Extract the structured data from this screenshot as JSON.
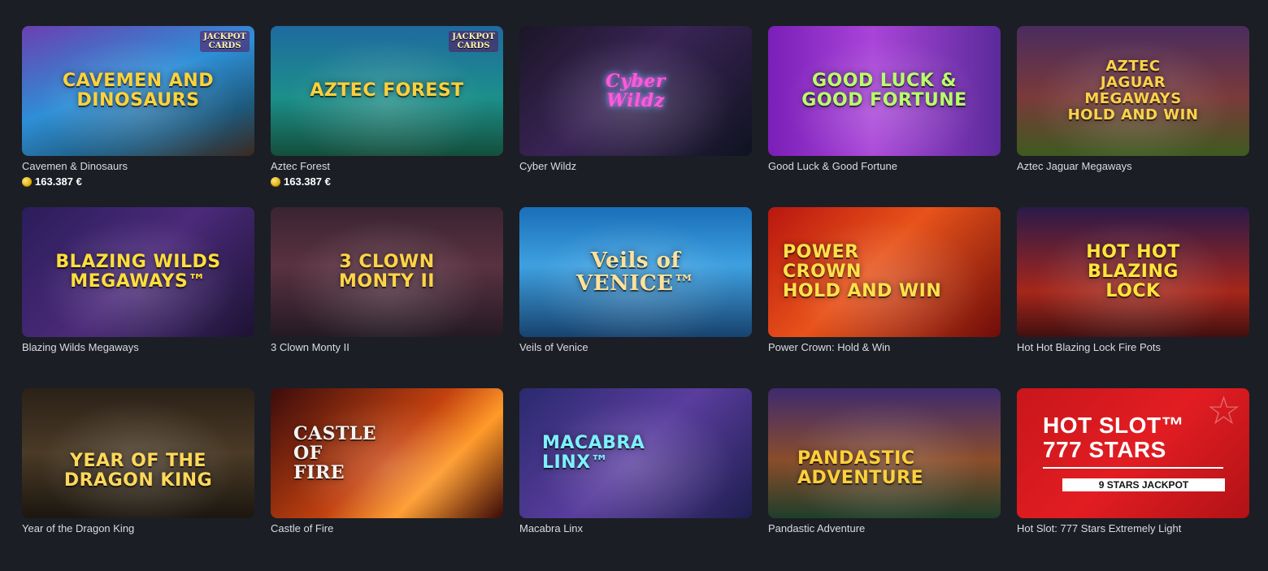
{
  "games": [
    {
      "title": "Cavemen & Dinosaurs",
      "logo": "CAVEMEN AND\nDINOSAURS",
      "badge": "JACKPOT\nCARDS",
      "jackpot": "163.387 €",
      "cls": "bg0",
      "logo_cls": "c-cave",
      "accent": "#ffd23a"
    },
    {
      "title": "Aztec Forest",
      "logo": "AZTEC FOREST",
      "badge": "JACKPOT\nCARDS",
      "jackpot": "163.387 €",
      "cls": "bg1",
      "logo_cls": "c-aztec",
      "accent": "#ffcf3a"
    },
    {
      "title": "Cyber Wildz",
      "logo": "Cyber\nWildz",
      "cls": "bg2",
      "logo_cls": "c-cyber",
      "accent": "#ff5ad6"
    },
    {
      "title": "Good Luck & Good Fortune",
      "logo": "GOOD LUCK &\nGOOD FORTUNE",
      "cls": "bg3",
      "logo_cls": "c-luck",
      "accent": "#b9ff6a"
    },
    {
      "title": "Aztec Jaguar Megaways",
      "logo": "AZTEC\nJAGUAR\nMEGAWAYS\nHOLD AND WIN",
      "cls": "bg4",
      "logo_cls": "c-jag",
      "accent": "#ffd24a"
    },
    {
      "title": "Blazing Wilds Megaways",
      "logo": "BLAZING WILDS\nMEGAWAYS™",
      "cls": "bg5",
      "logo_cls": "c-blaze",
      "accent": "#ffdf3a"
    },
    {
      "title": "3 Clown Monty II",
      "logo": "3 CLOWN\nMONTY II",
      "cls": "bg6",
      "logo_cls": "c-clown",
      "accent": "#ffd447"
    },
    {
      "title": "Veils of Venice",
      "logo": "Veils of\nVENICE™",
      "cls": "bg7",
      "logo_cls": "c-venice",
      "accent": "#ffe29a"
    },
    {
      "title": "Power Crown: Hold & Win",
      "logo": "POWER\nCROWN\nHOLD AND WIN",
      "cls": "bg8",
      "logo_cls": "c-power",
      "accent": "#ffe14a"
    },
    {
      "title": "Hot Hot Blazing Lock Fire Pots",
      "logo": "HOT HOT\nBLAZING\nLOCK",
      "cls": "bg9",
      "logo_cls": "c-hot",
      "accent": "#ffe53a"
    },
    {
      "title": "Year of the Dragon King",
      "logo": "YEAR OF THE\nDRAGON KING",
      "cls": "bg10",
      "logo_cls": "c-dragon",
      "accent": "#ffd85a"
    },
    {
      "title": "Castle of Fire",
      "logo": "CASTLE\nOF\nFIRE",
      "cls": "bg11",
      "logo_cls": "c-castle",
      "accent": "#f3f3f3"
    },
    {
      "title": "Macabra Linx",
      "logo": "MACABRA\nLINX™",
      "cls": "bg12",
      "logo_cls": "c-maca",
      "accent": "#7df0ff"
    },
    {
      "title": "Pandastic Adventure",
      "logo": "PANDASTIC\nADVENTURE",
      "cls": "bg13",
      "logo_cls": "c-panda",
      "accent": "#ffd03a"
    },
    {
      "title": "Hot Slot: 777 Stars Extremely Light",
      "logo": "HOT SLOT™\n777 STARS",
      "strip": "9 STARS JACKPOT",
      "cls": "bg14",
      "logo_cls": "c-star",
      "accent": "#ffffff"
    }
  ],
  "colors": {
    "page_background": "#1b1e25",
    "title_text": "#d9dce3",
    "jackpot_text": "#ffffff",
    "coin": "#e0a800"
  },
  "icons": {
    "jackpot_coin": "coin-bag-icon",
    "hot_slot_star": "star-icon"
  }
}
